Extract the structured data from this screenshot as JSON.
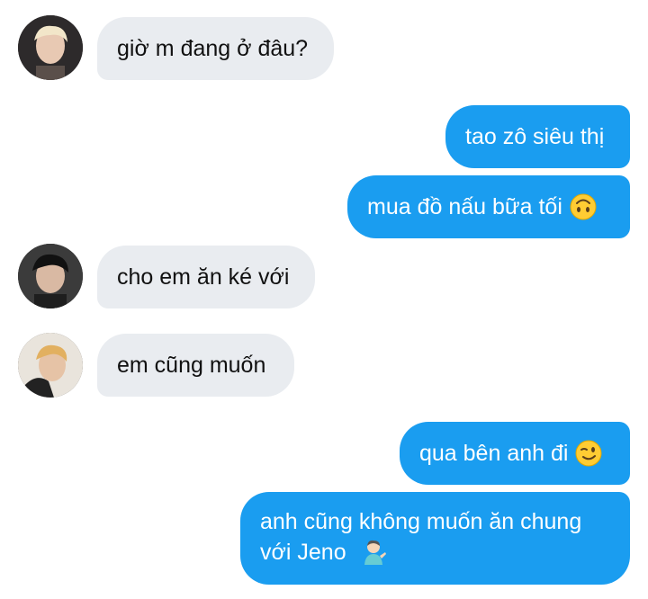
{
  "messages": [
    {
      "side": "in",
      "text": "giờ m đang ở đâu?"
    },
    {
      "side": "out",
      "text": "tao zô siêu thị"
    },
    {
      "side": "out",
      "text": "mua đồ nấu bữa tối",
      "emoji": "upside-down-face"
    },
    {
      "side": "in",
      "text": "cho em ăn ké với"
    },
    {
      "side": "in",
      "text": "em cũng muốn"
    },
    {
      "side": "out",
      "text": "qua bên anh đi",
      "emoji": "winking-face"
    },
    {
      "side": "out",
      "text_line1": "anh cũng không muốn ăn chung",
      "text_line2": "với Jeno",
      "emoji": "man-tipping-hand"
    }
  ],
  "colors": {
    "incoming_bubble": "#e9ecf0",
    "outgoing_bubble": "#1a9df0",
    "incoming_text": "#111111",
    "outgoing_text": "#ffffff"
  }
}
